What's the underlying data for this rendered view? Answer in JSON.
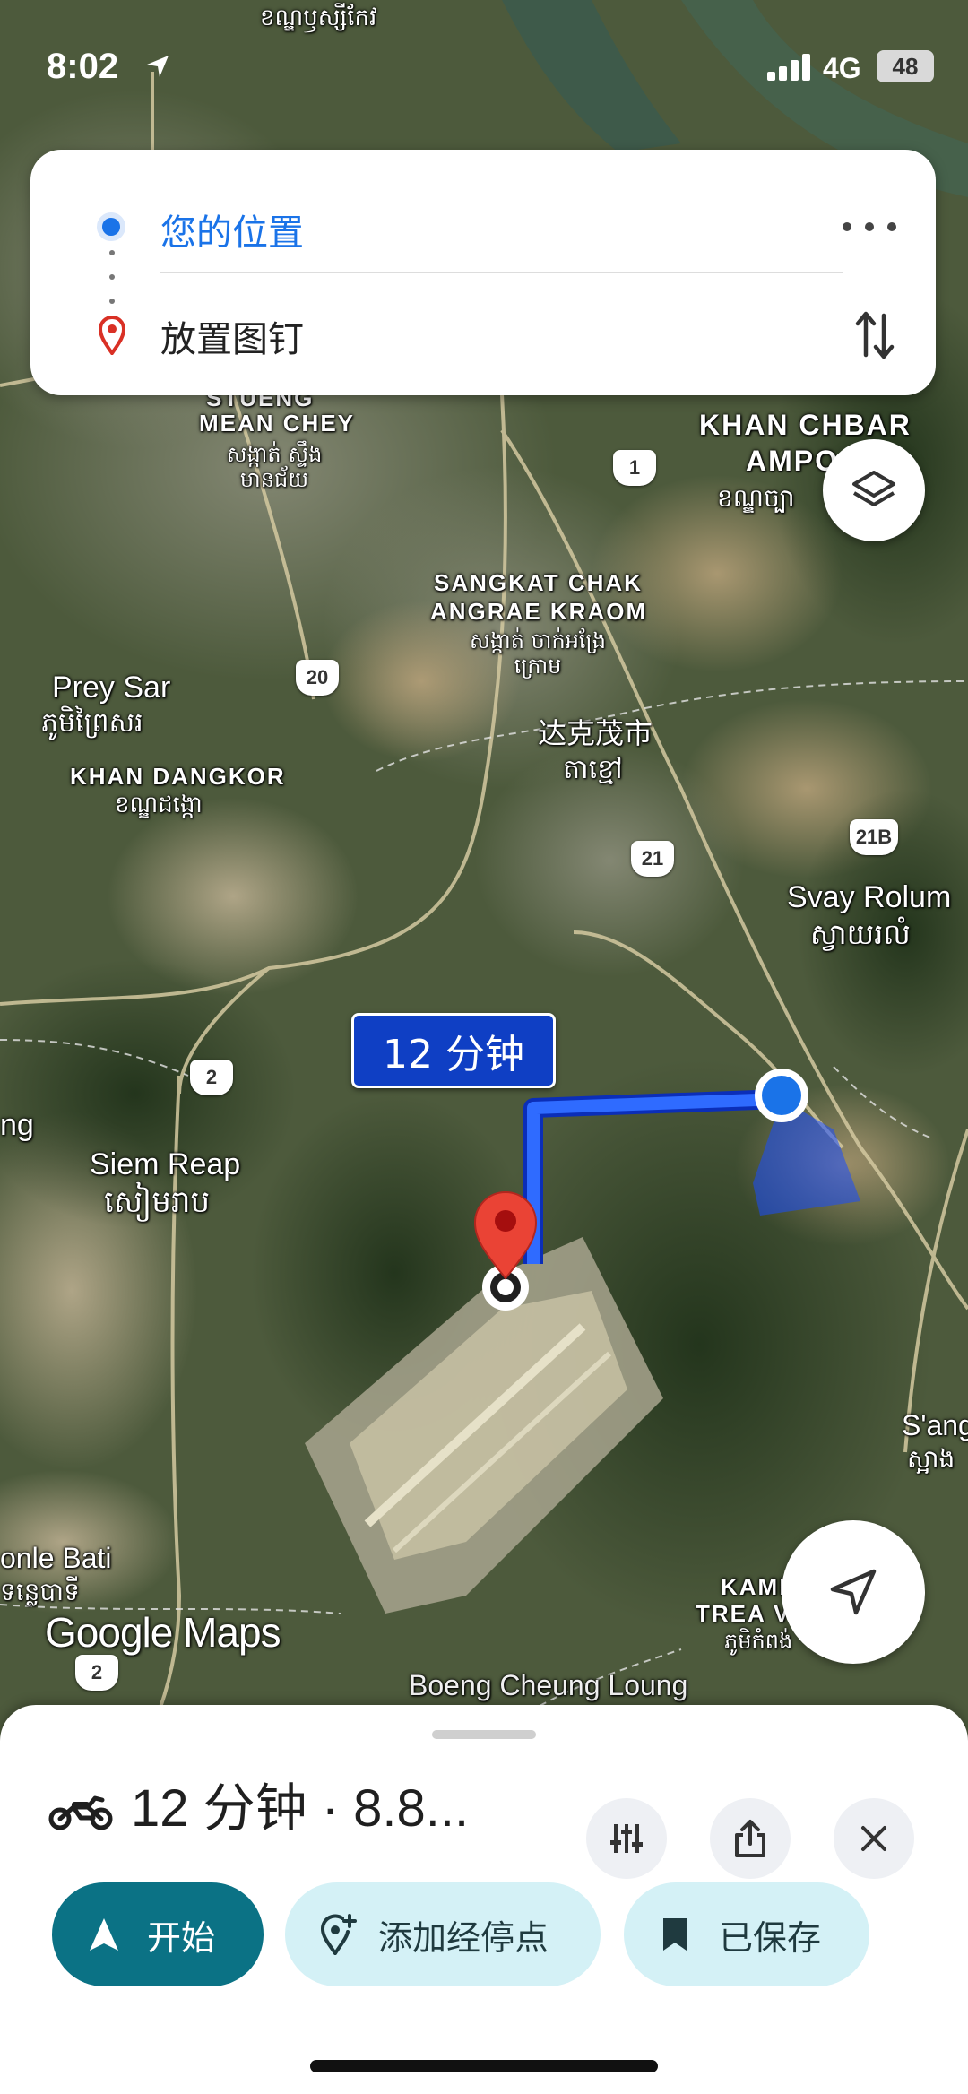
{
  "status_bar": {
    "time": "8:02",
    "network": "4G",
    "battery": "48"
  },
  "search": {
    "origin": "您的位置",
    "destination": "放置图钉"
  },
  "map": {
    "labels": {
      "top_khmer": "ខណ្ឌឫស្សីកែវ",
      "stueng": "STUENG",
      "mean_chey": "MEAN CHEY",
      "mean_chey_km": "សង្កាត់ ស្ទឹងមានជ័យ",
      "khan_chbar": "KHAN CHBAR",
      "ampo": "AMPO",
      "khan_chbar_km": "ខណ្ឌច្បា",
      "sangkat": "SANGKAT CHAK",
      "angrae": "ANGRAE KRAOM",
      "sangkat_km": "សង្កាត់ ចាក់អង្រែក្រោម",
      "takhmao_cn": "达克茂市",
      "takhmao_km": "តាខ្មៅ",
      "prey_sar": "Prey Sar",
      "prey_sar_km": "ភូមិព្រៃសរ",
      "khan_dangkor": "KHAN DANGKOR",
      "khan_dangkor_km": "ខណ្ឌដង្កោ",
      "svay_rolum": "Svay Rolum",
      "svay_rolum_km": "ស្វាយរលំ",
      "siem_reap": "Siem Reap",
      "siem_reap_km": "សៀមរាប",
      "ng": "ng",
      "s_ang": "S'ang",
      "s_ang_km": "ស្អាង",
      "tonle_bati": "onle Bati",
      "tonle_bati_km": "ទន្លេបាទី",
      "kamp": "KAMP",
      "trea": "TREA V",
      "trea_km": "ភូមិកំពង់",
      "boeng": "Boeng Cheung Loung"
    },
    "shields": {
      "r1": "1",
      "r20": "20",
      "r21": "21",
      "r21b": "21B",
      "r2a": "2",
      "r2b": "2"
    },
    "route_label": "12 分钟",
    "logo": "Google Maps"
  },
  "sheet": {
    "summary": "12 分钟 · 8.8...",
    "start": "开始",
    "add_stop": "添加经停点",
    "saved": "已保存"
  },
  "colors": {
    "accent_blue": "#1a73e8",
    "route_blue": "#1c47f0",
    "start_teal": "#0b7285",
    "chip_bg": "#d4f1f6"
  },
  "icons": [
    "location-arrow-icon",
    "signal-icon",
    "more-icon",
    "pin-icon",
    "swap-icon",
    "layers-icon",
    "my-location-icon",
    "motorcycle-icon",
    "filter-icon",
    "share-icon",
    "close-icon",
    "navigation-icon",
    "add-stop-icon",
    "bookmark-icon"
  ]
}
